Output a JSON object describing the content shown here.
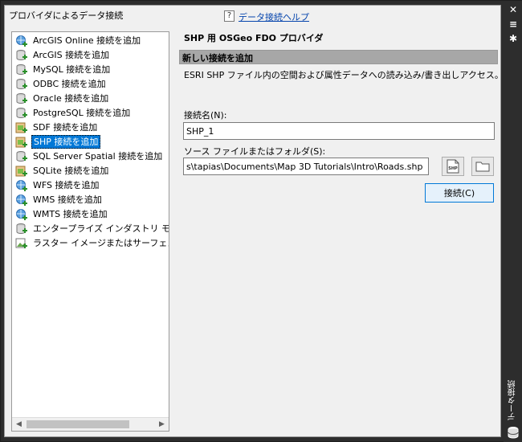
{
  "left_panel": {
    "title": "プロバイダによるデータ接続",
    "items": [
      {
        "label": "ArcGIS Online 接続を追加",
        "icon": "globe-db-icon"
      },
      {
        "label": "ArcGIS 接続を追加",
        "icon": "db-add-icon"
      },
      {
        "label": "MySQL 接続を追加",
        "icon": "db-add-icon"
      },
      {
        "label": "ODBC 接続を追加",
        "icon": "db-add-icon"
      },
      {
        "label": "Oracle 接続を追加",
        "icon": "db-add-icon"
      },
      {
        "label": "PostgreSQL 接続を追加",
        "icon": "db-add-icon"
      },
      {
        "label": "SDF 接続を追加",
        "icon": "file-add-icon"
      },
      {
        "label": "SHP 接続を追加",
        "icon": "file-add-icon",
        "selected": true
      },
      {
        "label": "SQL Server Spatial 接続を追加",
        "icon": "db-add-icon"
      },
      {
        "label": "SQLite 接続を追加",
        "icon": "file-add-icon"
      },
      {
        "label": "WFS 接続を追加",
        "icon": "globe-db-icon"
      },
      {
        "label": "WMS 接続を追加",
        "icon": "globe-db-icon"
      },
      {
        "label": "WMTS 接続を追加",
        "icon": "globe-db-icon"
      },
      {
        "label": "エンタープライズ インダストリ モデル 接",
        "icon": "db-add-icon"
      },
      {
        "label": "ラスター イメージまたはサーフェス 接続",
        "icon": "raster-add-icon"
      }
    ]
  },
  "help": {
    "label": "データ接続ヘルプ",
    "icon_text": "?"
  },
  "provider": {
    "title": "SHP 用 OSGeo FDO プロバイダ",
    "section_title": "新しい接続を追加",
    "description": "ESRI SHP ファイル内の空間および属性データへの読み込み/書き出しアクセス。"
  },
  "form": {
    "name_label": "接続名(N):",
    "name_value": "SHP_1",
    "source_label": "ソース ファイルまたはフォルダ(S):",
    "source_value": "s\\tapias\\Documents\\Map 3D Tutorials\\Intro\\Roads.shp",
    "shp_icon_text": "SHP",
    "connect_label": "接続(C)"
  },
  "strip": {
    "title": "データ接続"
  },
  "colors": {
    "selection": "#0078d7",
    "section_bar": "#a7a7a7",
    "link": "#0645ad"
  }
}
